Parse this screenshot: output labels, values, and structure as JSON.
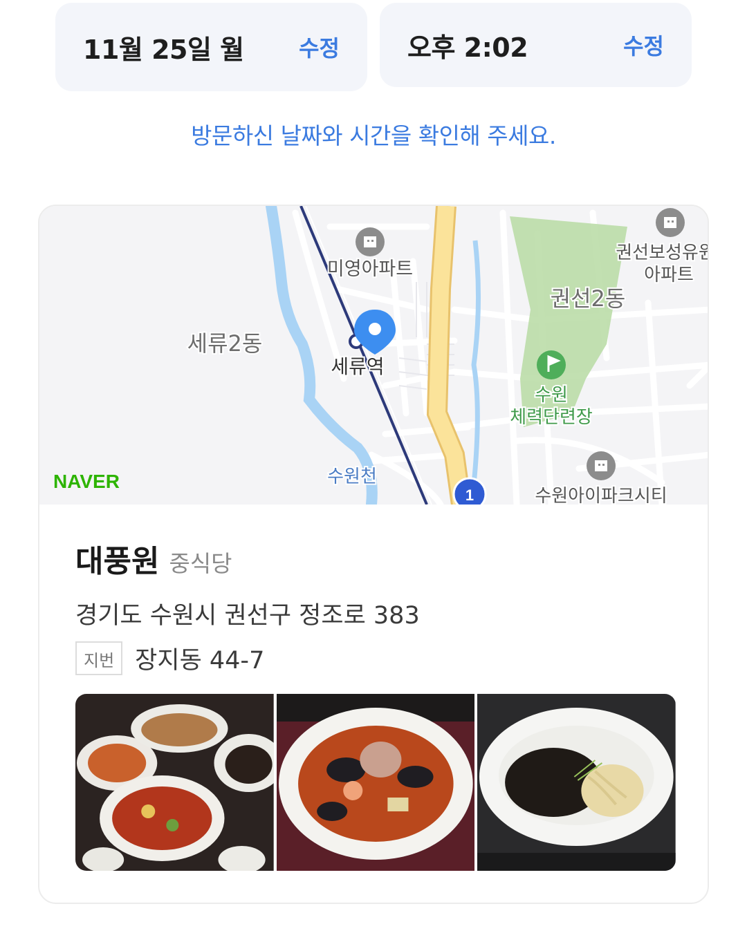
{
  "visit": {
    "date": "11월 25일 월",
    "date_edit": "수정",
    "time": "오후 2:02",
    "time_edit": "수정",
    "notice": "방문하신 날짜와 시간을 확인해 주세요."
  },
  "map": {
    "provider": "NAVER",
    "labels": {
      "miyoung": "미영아파트",
      "seryu2dong": "세류2동",
      "seryu_station": "세류역",
      "gwonseon2dong": "권선2동",
      "gwonseon_boseong_1": "권선보성유원",
      "gwonseon_boseong_2": "아파트",
      "suwon_1": "수원",
      "suwon_2": "체력단련장",
      "suwoncheon": "수원천",
      "ipark": "수원아이파크시티",
      "route_number": "1"
    },
    "colors": {
      "pin": "#3d8ef0",
      "road_major": "#fbe39a",
      "water": "#a9d3f5",
      "park": "#b7dba3"
    }
  },
  "place": {
    "name": "대풍원",
    "category": "중식당",
    "address": "경기도 수원시 권선구 정조로 383",
    "lot_badge": "지번",
    "lot_address": "장지동 44-7"
  },
  "photos": [
    {
      "icon": "dish-platter-photo"
    },
    {
      "icon": "seafood-jjamppong-photo"
    },
    {
      "icon": "jajangmyeon-photo"
    }
  ]
}
